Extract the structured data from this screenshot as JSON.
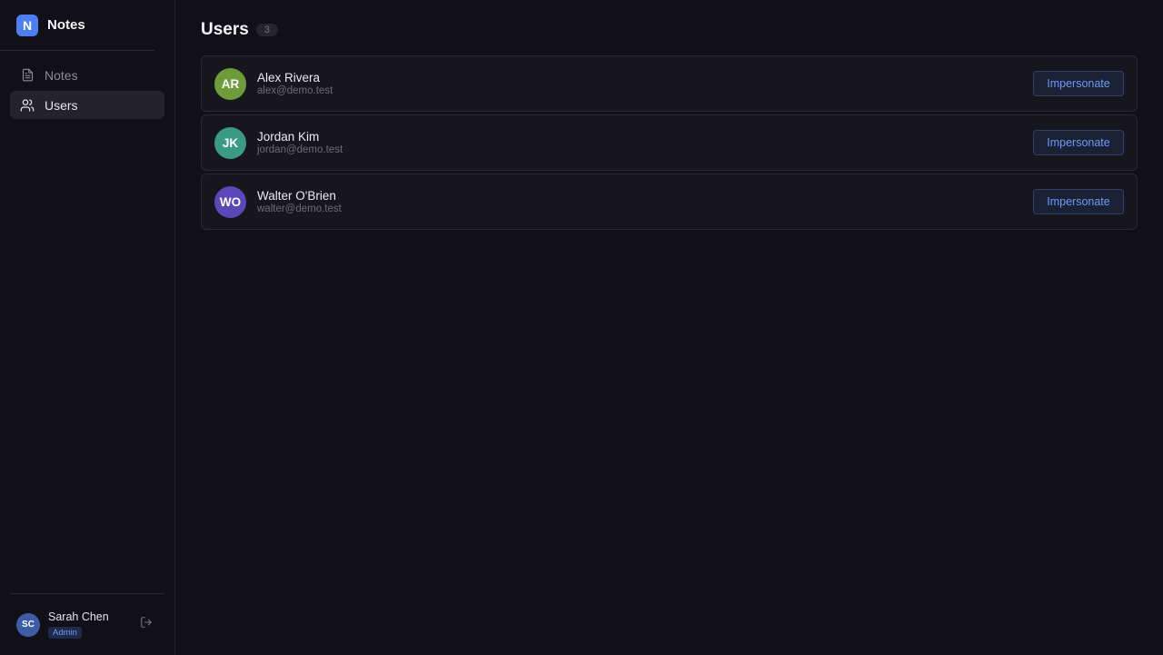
{
  "brand": {
    "logo_letter": "N",
    "name": "Notes",
    "accent": "#4e7ff2"
  },
  "nav": {
    "items": [
      {
        "label": "Notes",
        "icon": "document-icon",
        "active": false
      },
      {
        "label": "Users",
        "icon": "users-icon",
        "active": true
      }
    ]
  },
  "current_user": {
    "initials": "SC",
    "name": "Sarah Chen",
    "role": "Admin",
    "logout_icon": "logout-icon"
  },
  "page": {
    "title": "Users",
    "count": "3"
  },
  "users": [
    {
      "initials": "AR",
      "name": "Alex Rivera",
      "email": "alex@demo.test",
      "avatar_color": "#6e9c3b",
      "action": "Impersonate"
    },
    {
      "initials": "JK",
      "name": "Jordan Kim",
      "email": "jordan@demo.test",
      "avatar_color": "#3a9a83",
      "action": "Impersonate"
    },
    {
      "initials": "WO",
      "name": "Walter O'Brien",
      "email": "walter@demo.test",
      "avatar_color": "#5b47b8",
      "action": "Impersonate"
    }
  ]
}
